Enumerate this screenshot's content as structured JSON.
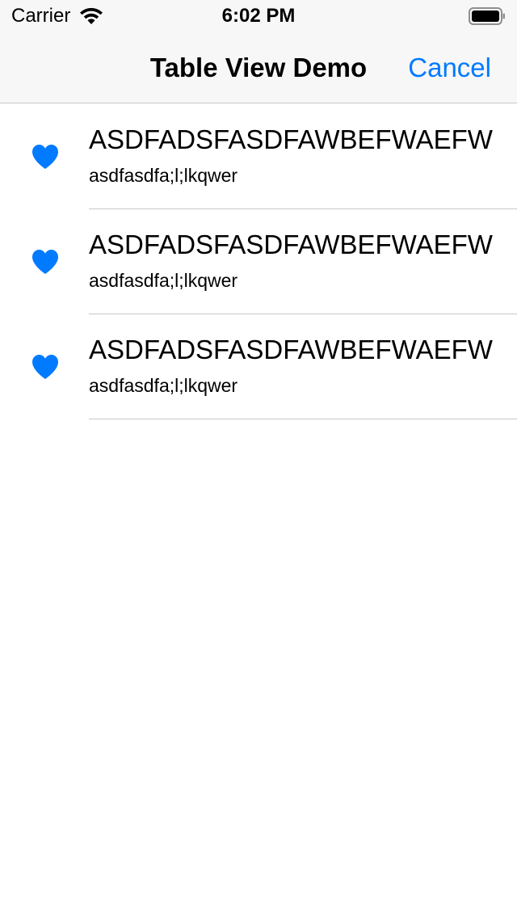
{
  "status_bar": {
    "carrier": "Carrier",
    "time": "6:02 PM",
    "icons": [
      "wifi-icon",
      "battery-icon"
    ]
  },
  "nav_bar": {
    "title": "Table View Demo",
    "cancel_label": "Cancel"
  },
  "table": {
    "rows": [
      {
        "icon": "heart-icon",
        "title": "ASDFADSFASDFAWBEFWAEFW",
        "subtitle": "asdfasdfa;l;lkqwer"
      },
      {
        "icon": "heart-icon",
        "title": "ASDFADSFASDFAWBEFWAEFW",
        "subtitle": "asdfasdfa;l;lkqwer"
      },
      {
        "icon": "heart-icon",
        "title": "ASDFADSFASDFAWBEFWAEFW",
        "subtitle": "asdfasdfa;l;lkqwer"
      }
    ]
  },
  "colors": {
    "accent": "#007aff",
    "bar_background": "#f7f7f7",
    "separator": "#c8c7cc"
  }
}
